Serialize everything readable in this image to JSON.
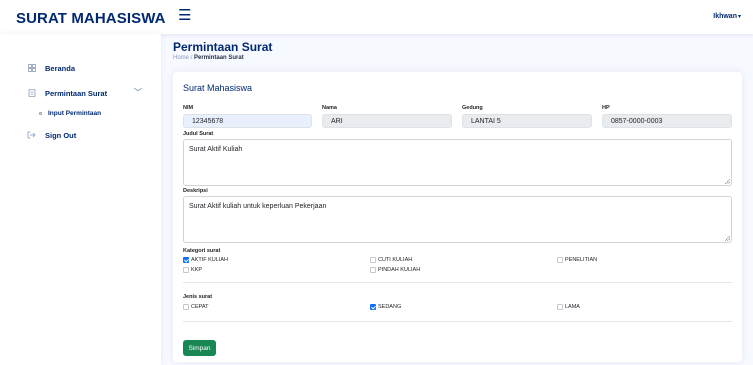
{
  "header": {
    "logo": "SURAT MAHASISWA",
    "menu_icon": "hamburger-icon",
    "user": "Ikhwan"
  },
  "sidebar": {
    "items": [
      {
        "label": "Beranda",
        "icon": "grid-icon"
      },
      {
        "label": "Permintaan Surat",
        "icon": "document-icon"
      },
      {
        "label": "Input Permintaan",
        "icon": "circle-icon"
      },
      {
        "label": "Sign Out",
        "icon": "sign-out-icon"
      }
    ]
  },
  "page": {
    "title": "Permintaan Surat",
    "breadcrumb_home": "Home",
    "breadcrumb_sep": "/",
    "breadcrumb_current": "Permintaan Surat"
  },
  "form": {
    "card_title": "Surat Mahasiswa",
    "nim_label": "NIM",
    "nim_value": "12345678",
    "nama_label": "Nama",
    "nama_value": "ARI",
    "gedung_label": "Gedung",
    "gedung_value": "LANTAI 5",
    "hp_label": "HP",
    "hp_value": "0857-0000-0003",
    "judul_label": "Judul Surat",
    "judul_value": "Surat Aktif Kuliah",
    "deskripsi_label": "Deskripsi",
    "deskripsi_value": "Surat Aktif kuliah untuk keperluan Pekerjaan",
    "kategori_label": "Kategori surat",
    "kategori_options": [
      {
        "label": "AKTIF KULIAH",
        "checked": true
      },
      {
        "label": "CUTI KULIAH",
        "checked": false
      },
      {
        "label": "PENELITIAN",
        "checked": false
      },
      {
        "label": "KKP",
        "checked": false
      },
      {
        "label": "PINDAH KULIAH",
        "checked": false
      }
    ],
    "jenis_label": "Jenis surat",
    "jenis_options": [
      {
        "label": "CEPAT",
        "checked": false
      },
      {
        "label": "SEDANG",
        "checked": true
      },
      {
        "label": "LAMA",
        "checked": false
      }
    ],
    "save_label": "Simpan"
  },
  "colors": {
    "primary": "#012970",
    "accent": "#0d6efd",
    "save": "#198754",
    "background": "#f6f9ff"
  }
}
